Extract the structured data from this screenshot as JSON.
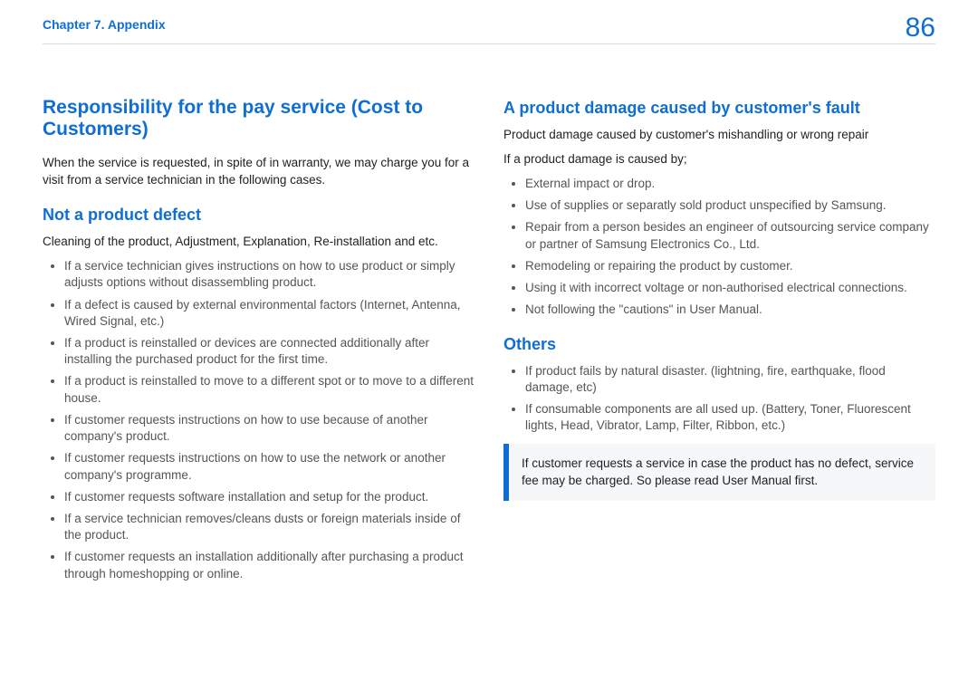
{
  "header": {
    "chapter": "Chapter 7. Appendix",
    "page_number": "86"
  },
  "left": {
    "title": "Responsibility for the pay service (Cost to Customers)",
    "intro": "When the service is requested, in spite of in warranty, we may charge you for a visit from a service technician in the following cases.",
    "section_title": "Not a product defect",
    "section_intro": "Cleaning of the product, Adjustment, Explanation, Re-installation and etc.",
    "bullets": [
      "If a service technician gives instructions on how to use product or simply adjusts options without disassembling product.",
      "If a defect is caused by external environmental factors (Internet, Antenna, Wired Signal, etc.)",
      "If a product is reinstalled or devices are connected additionally after installing the purchased product for the first time.",
      "If a product is reinstalled to move to a different spot or to move to a different house.",
      "If customer requests instructions on how to use because of another company's product.",
      "If customer requests instructions on how to use the network or another company's programme.",
      "If customer requests software installation and setup for the product.",
      "If a service technician removes/cleans dusts or foreign materials inside of the product.",
      "If customer requests an installation additionally after purchasing a product through homeshopping or online."
    ]
  },
  "right": {
    "section1_title": "A product damage caused by customer's fault",
    "section1_intro1": "Product damage caused by customer's mishandling or wrong repair",
    "section1_intro2": "If a product damage is caused by;",
    "section1_bullets": [
      "External impact or drop.",
      "Use of supplies or separatly sold product unspecified by Samsung.",
      "Repair from a person besides an engineer of outsourcing service company or partner of Samsung Electronics Co., Ltd.",
      "Remodeling or repairing the product by customer.",
      "Using it with incorrect voltage or non-authorised electrical connections.",
      "Not following the \"cautions\" in User Manual."
    ],
    "section2_title": "Others",
    "section2_bullets": [
      "If product fails by natural disaster. (lightning, fire, earthquake, flood damage, etc)",
      "If consumable components are all used up. (Battery, Toner, Fluorescent lights, Head, Vibrator, Lamp, Filter, Ribbon, etc.)"
    ],
    "note": "If customer requests a service in case the product has no defect, service fee may be charged. So please read User Manual first."
  }
}
